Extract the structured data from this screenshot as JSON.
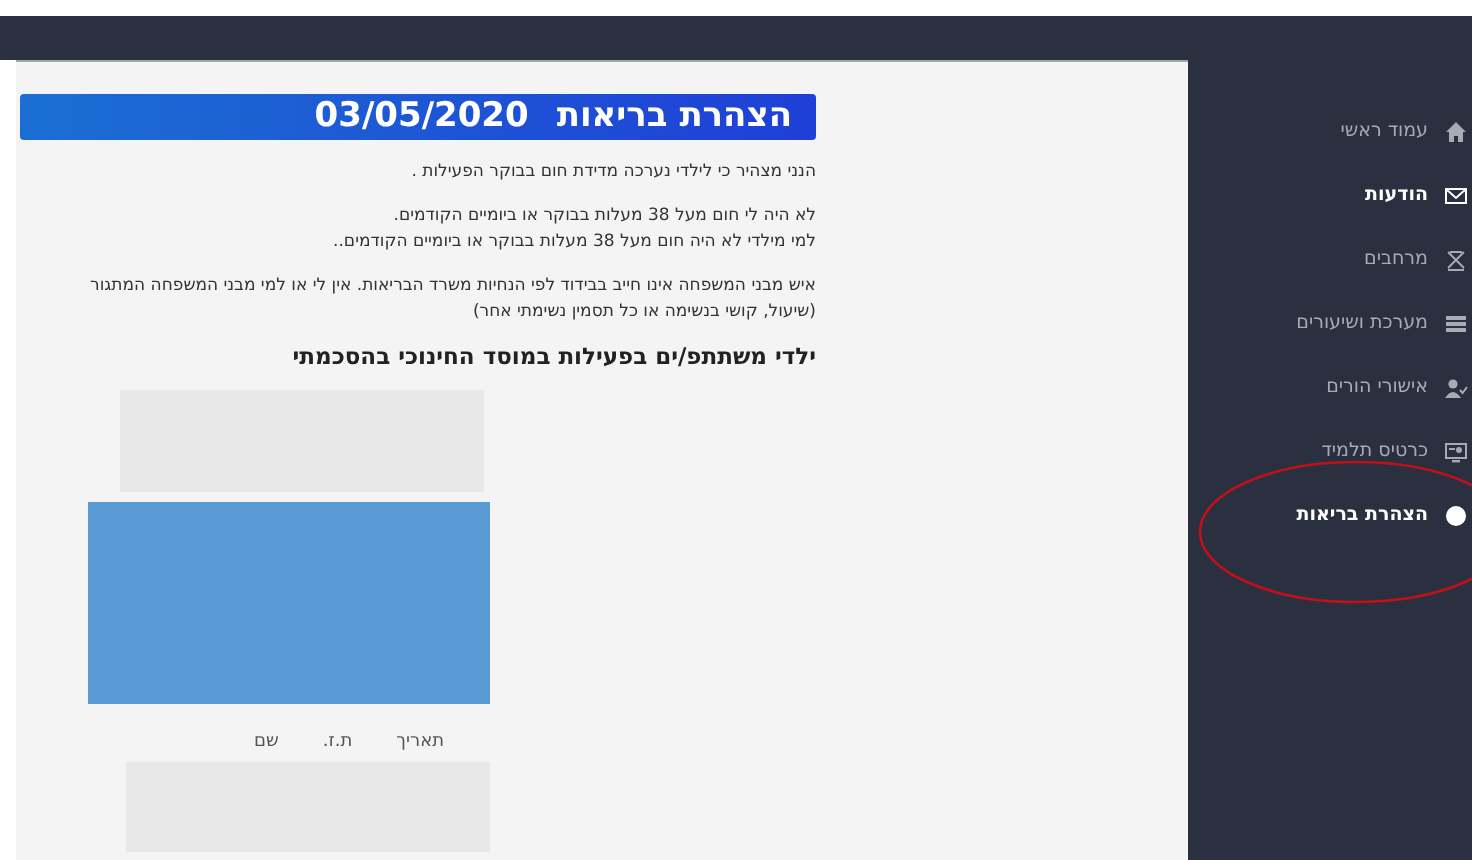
{
  "header": {
    "title": "הצהרת בריאות",
    "date": "03/05/2020"
  },
  "paragraphs": [
    {
      "lines": [
        "הנני מצהיר כי לילדי נערכה מדידת חום בבוקר הפעילות ."
      ]
    },
    {
      "lines": [
        "לא היה לי חום  מעל  38 מעלות בבוקר  או ביומיים הקודמים.",
        "למי מילדי לא היה חום  מעל  38 מעלות בבוקר  או ביומיים הקודמים.."
      ]
    },
    {
      "lines": [
        "איש מבני המשפחה אינו חייב בבידוד לפי הנחיות משרד הבריאות. אין לי או למי מבני המשפחה המתגור",
        "(שיעול, קושי בנשימה או כל תסמין נשימתי אחר)"
      ]
    }
  ],
  "section_heading": "ילדי משתתפ/ים  בפעילות במוסד החינוכי בהסכמתי",
  "table": {
    "columns": [
      "תאריך",
      "ת.ז.",
      "שם"
    ]
  },
  "sidebar": {
    "items": [
      {
        "label": "עמוד ראשי",
        "selected": false
      },
      {
        "label": "הודעות",
        "selected": true
      },
      {
        "label": "מרחבים",
        "selected": false
      },
      {
        "label": "מערכת ושיעורים",
        "selected": false
      },
      {
        "label": "אישורי הורים",
        "selected": false
      },
      {
        "label": "כרטיס תלמיד",
        "selected": false
      },
      {
        "label": "הצהרת בריאות",
        "selected": true
      }
    ]
  }
}
